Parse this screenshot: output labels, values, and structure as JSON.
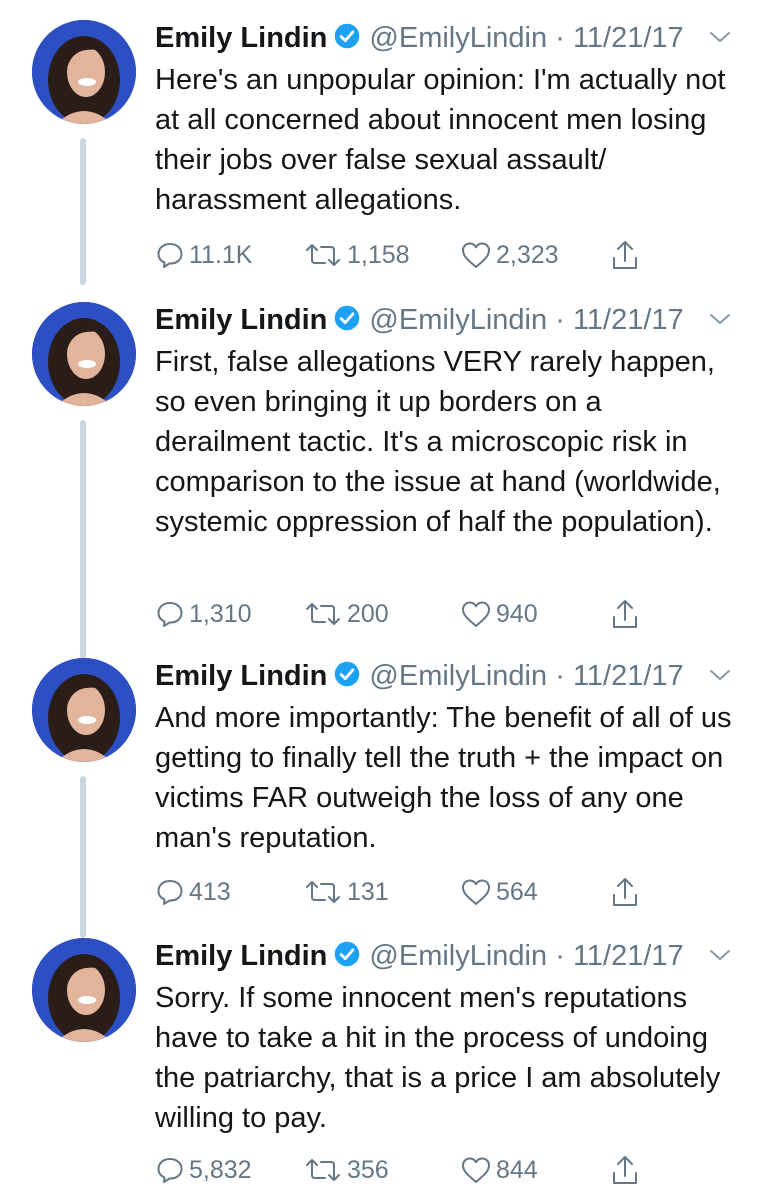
{
  "tweets": [
    {
      "name": "Emily Lindin",
      "handle": "@EmilyLindin",
      "separator": "·",
      "date": "11/21/17",
      "text": "Here's an unpopular opinion: I'm actually not at all concerned about innocent men losing their jobs over false sexual assault/ harassment allegations.",
      "replies": "11.1K",
      "retweets": "1,158",
      "likes": "2,323"
    },
    {
      "name": "Emily Lindin",
      "handle": "@EmilyLindin",
      "separator": "·",
      "date": "11/21/17",
      "text": "First, false allegations VERY rarely happen, so even bringing it up borders on a derailment tactic. It's a microscopic risk in comparison to the issue at hand (worldwide, systemic oppression of half the population).",
      "replies": "1,310",
      "retweets": "200",
      "likes": "940"
    },
    {
      "name": "Emily Lindin",
      "handle": "@EmilyLindin",
      "separator": "·",
      "date": "11/21/17",
      "text": "And more importantly: The benefit of all of us getting to finally tell the truth + the impact on victims FAR outweigh the loss of any one man's reputation.",
      "replies": "413",
      "retweets": "131",
      "likes": "564"
    },
    {
      "name": "Emily Lindin",
      "handle": "@EmilyLindin",
      "separator": "·",
      "date": "11/21/17",
      "text": "Sorry. If some innocent men's reputations have to take a hit in the process of undoing the patriarchy, that is a price I am absolutely willing to pay.",
      "replies": "5,832",
      "retweets": "356",
      "likes": "844"
    }
  ],
  "colors": {
    "text": "#14171a",
    "secondary": "#657786",
    "verified": "#1da1f2",
    "thread_line": "#ccd6dd"
  }
}
